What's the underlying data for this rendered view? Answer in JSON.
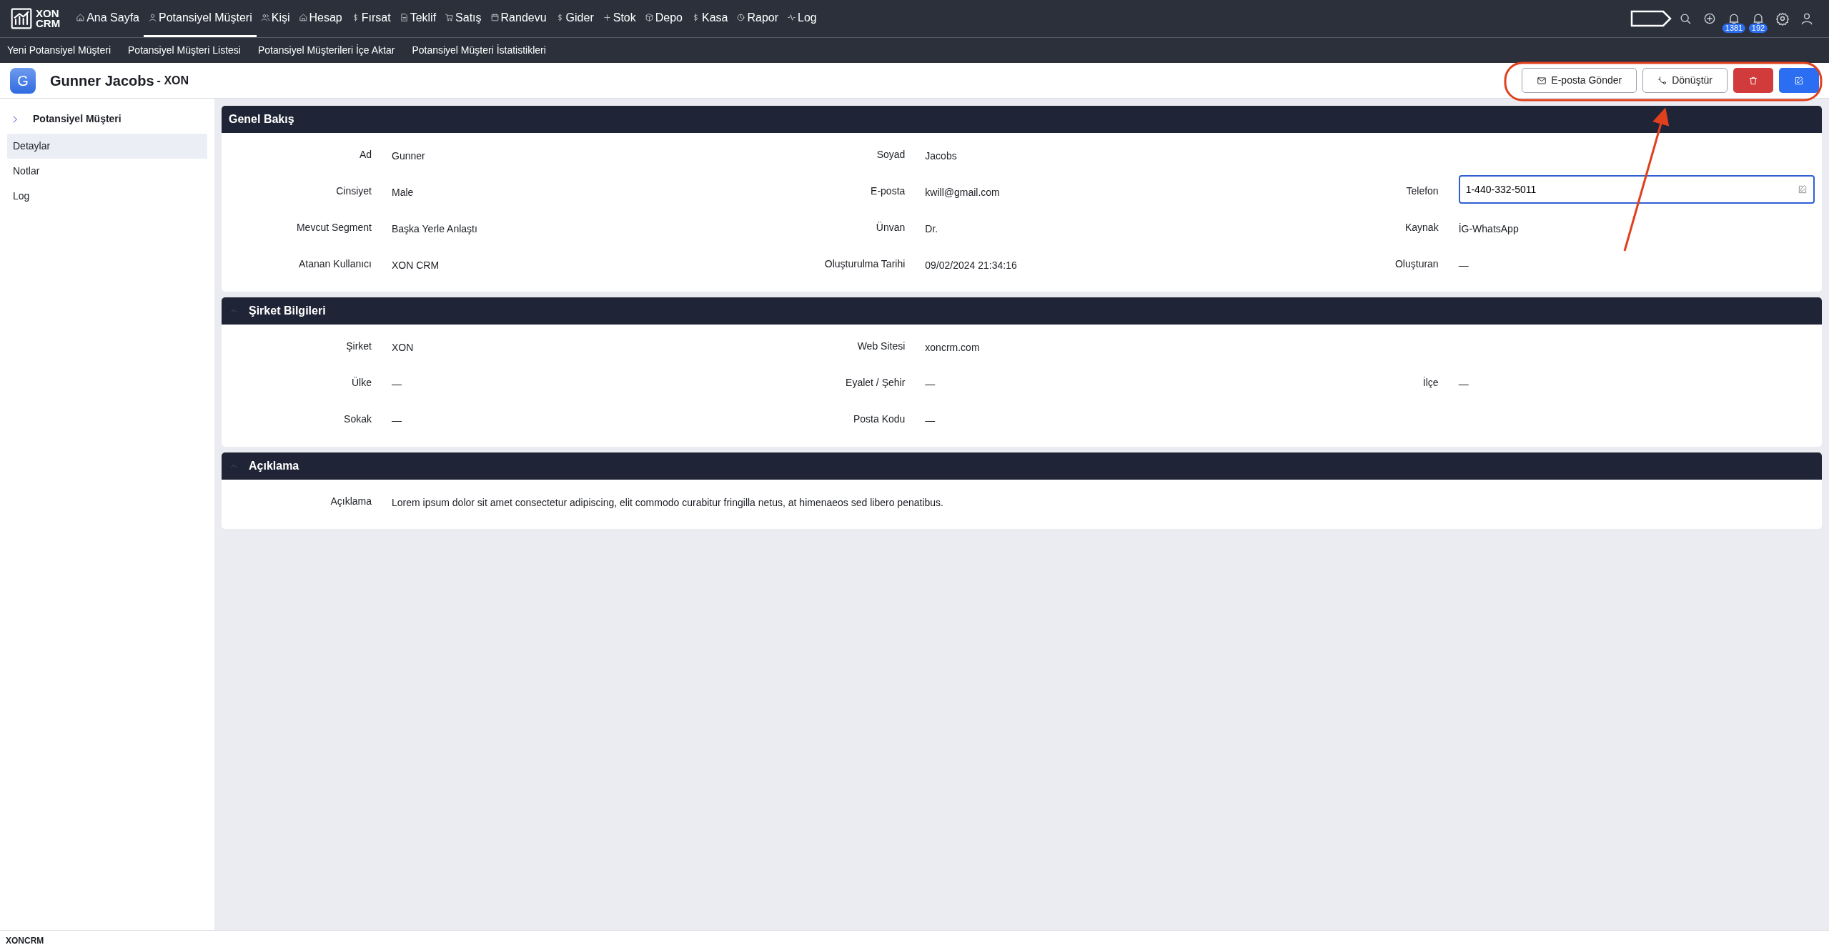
{
  "nav": {
    "logo": [
      "XON",
      "CRM"
    ],
    "items": [
      {
        "label": "Ana Sayfa",
        "selected": false
      },
      {
        "label": "Potansiyel Müşteri",
        "selected": true
      },
      {
        "label": "Kişi",
        "selected": false
      },
      {
        "label": "Hesap",
        "selected": false
      },
      {
        "label": "Fırsat",
        "selected": false
      },
      {
        "label": "Teklif",
        "selected": false
      },
      {
        "label": "Satış",
        "selected": false
      },
      {
        "label": "Randevu",
        "selected": false
      },
      {
        "label": "Gider",
        "selected": false
      },
      {
        "label": "Stok",
        "selected": false
      },
      {
        "label": "Depo",
        "selected": false
      },
      {
        "label": "Kasa",
        "selected": false
      },
      {
        "label": "Rapor",
        "selected": false
      },
      {
        "label": "Log",
        "selected": false
      }
    ],
    "badges": [
      "1381",
      "192"
    ]
  },
  "subnav": [
    "Yeni Potansiyel Müşteri",
    "Potansiyel Müşteri Listesi",
    "Potansiyel Müşterileri İçe Aktar",
    "Potansiyel Müşteri İstatistikleri"
  ],
  "header": {
    "avatar": "G",
    "name": "Gunner Jacobs",
    "suffix": "- XON",
    "buttons": [
      {
        "kind": "outline",
        "label": "E-posta Gönder"
      },
      {
        "kind": "outline",
        "label": "Dönüştür"
      },
      {
        "kind": "danger"
      },
      {
        "kind": "primary"
      }
    ]
  },
  "sidebar": {
    "heading": "Potansiyel Müşteri",
    "items": [
      {
        "label": "Detaylar",
        "selected": true
      },
      {
        "label": "Notlar",
        "selected": false
      },
      {
        "label": "Log",
        "selected": false
      }
    ]
  },
  "sections": [
    {
      "title": "Genel Bakış",
      "collapsible": false,
      "rows": [
        [
          {
            "label": "Ad",
            "value": "Gunner"
          },
          {
            "label": "Soyad",
            "value": "Jacobs"
          }
        ],
        [
          {
            "label": "Cinsiyet",
            "value": "Male"
          },
          {
            "label": "E-posta",
            "value": "kwill@gmail.com"
          },
          {
            "label": "Telefon",
            "value": "1-440-332-5011",
            "kind": "input",
            "focused": true
          }
        ],
        [
          {
            "label": "Mevcut Segment",
            "value": "Başka Yerle Anlaştı"
          },
          {
            "label": "Ünvan",
            "value": "Dr."
          },
          {
            "label": "Kaynak",
            "value": "İG-WhatsApp"
          }
        ],
        [
          {
            "label": "Atanan Kullanıcı",
            "value": "XON CRM"
          },
          {
            "label": "Oluşturulma Tarihi",
            "value": "09/02/2024 21:34:16"
          },
          {
            "label": "Oluşturan",
            "value": "—"
          }
        ]
      ]
    },
    {
      "title": "Şirket Bilgileri",
      "collapsible": true,
      "rows": [
        [
          {
            "label": "Şirket",
            "value": "XON"
          },
          {
            "label": "Web Sitesi",
            "value": "xoncrm.com"
          }
        ],
        [
          {
            "label": "Ülke",
            "value": "—"
          },
          {
            "label": "Eyalet / Şehir",
            "value": "—"
          },
          {
            "label": "İlçe",
            "value": "—"
          }
        ],
        [
          {
            "label": "Sokak",
            "value": "—"
          },
          {
            "label": "Posta Kodu",
            "value": "—"
          }
        ]
      ]
    },
    {
      "title": "Açıklama",
      "collapsible": true,
      "rows": [
        [
          {
            "label": "Açıklama",
            "value": "Lorem ipsum dolor sit amet consectetur adipiscing, elit commodo curabitur fringilla netus, at himenaeos sed libero penatibus.",
            "kind": "wide"
          }
        ]
      ]
    }
  ],
  "footer": "XONCRM",
  "annotation": {
    "outline": true,
    "arrow": true
  }
}
